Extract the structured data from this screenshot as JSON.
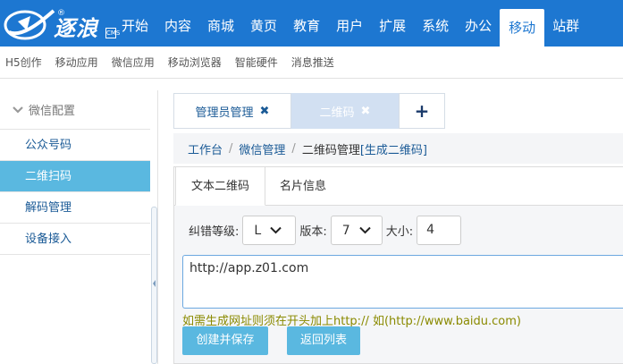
{
  "brand": {
    "name": "逐浪",
    "reg_mark": "®",
    "badge": "CMS",
    "accent": "#1d77d1"
  },
  "top_nav": [
    {
      "label": "开始"
    },
    {
      "label": "内容"
    },
    {
      "label": "商城"
    },
    {
      "label": "黄页"
    },
    {
      "label": "教育"
    },
    {
      "label": "用户"
    },
    {
      "label": "扩展"
    },
    {
      "label": "系统"
    },
    {
      "label": "办公"
    },
    {
      "label": "移动",
      "active": true
    },
    {
      "label": "站群"
    }
  ],
  "sub_nav": [
    {
      "label": "H5创作"
    },
    {
      "label": "移动应用"
    },
    {
      "label": "微信应用"
    },
    {
      "label": "移动浏览器"
    },
    {
      "label": "智能硬件"
    },
    {
      "label": "消息推送"
    }
  ],
  "sidebar": {
    "section": "微信配置",
    "items": [
      {
        "label": "公众号码"
      },
      {
        "label": "二维扫码",
        "active": true
      },
      {
        "label": "解码管理"
      },
      {
        "label": "设备接入"
      }
    ]
  },
  "tabs": [
    {
      "label": "管理员管理",
      "close": "✖"
    },
    {
      "label": "二维码",
      "close": "✖",
      "active": true
    }
  ],
  "tab_add": "+",
  "breadcrumb": {
    "home": "工作台",
    "sep": "/",
    "parent": "微信管理",
    "current": "二维码管理",
    "action": "[生成二维码]"
  },
  "panel": {
    "tabs": [
      {
        "label": "文本二维码"
      },
      {
        "label": "名片信息"
      }
    ],
    "error_level_label": "纠错等级:",
    "error_level_value": "L",
    "version_label": "版本:",
    "version_value": "7",
    "size_label": "大小:",
    "size_value": "4",
    "content": "http://app.z01.com",
    "hint": "如需生成网址则须在开头加上http:// 如(http://www.baidu.com)",
    "save_button": "创建并保存",
    "back_button": "返回列表"
  }
}
